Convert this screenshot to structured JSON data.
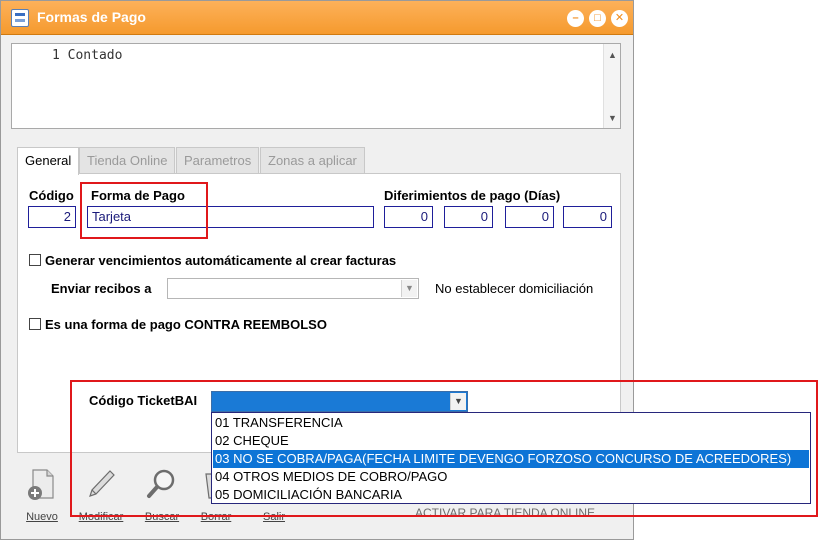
{
  "window": {
    "title": "Formas de Pago",
    "controls": [
      "minimize-icon",
      "maximize-icon",
      "close-icon"
    ]
  },
  "memo": {
    "line": "1 Contado"
  },
  "tabs": [
    {
      "label": "General",
      "active": true
    },
    {
      "label": "Tienda Online",
      "active": false
    },
    {
      "label": "Parametros",
      "active": false
    },
    {
      "label": "Zonas a aplicar",
      "active": false
    }
  ],
  "general": {
    "codigo_label": "Código",
    "codigo_value": "2",
    "forma_label": "Forma de Pago",
    "forma_value": "Tarjeta",
    "diferimientos_label": "Diferimientos de pago (Días)",
    "diferimientos": [
      "0",
      "0",
      "0",
      "0"
    ],
    "generar_label": "Generar vencimientos automáticamente al crear facturas",
    "enviar_label": "Enviar recibos a",
    "enviar_value": "",
    "domiciliacion_label": "No establecer domiciliación",
    "reembolso_label": "Es una forma de pago CONTRA REEMBOLSO",
    "ticketbai_label": "Código TicketBAI",
    "ticketbai_value": ""
  },
  "ticketbai_options": [
    "01 TRANSFERENCIA",
    "02 CHEQUE",
    "03 NO SE COBRA/PAGA(FECHA LIMITE DEVENGO FORZOSO CONCURSO DE ACREEDORES)",
    "04 OTROS MEDIOS DE COBRO/PAGO",
    "05 DOMICILIACIÓN BANCARIA"
  ],
  "ticketbai_selected_index": 2,
  "toolbar": {
    "nuevo": "Nuevo",
    "modificar": "Modificar",
    "buscar": "Buscar",
    "borrar": "Borrar",
    "salir": "Salir",
    "activar": "ACTIVAR PARA TIENDA ONLINE"
  },
  "colors": {
    "titlebar": "#f59a2e",
    "highlight": "#e0181b",
    "selection": "#0d74d6",
    "field_border": "#1f1f9a"
  }
}
